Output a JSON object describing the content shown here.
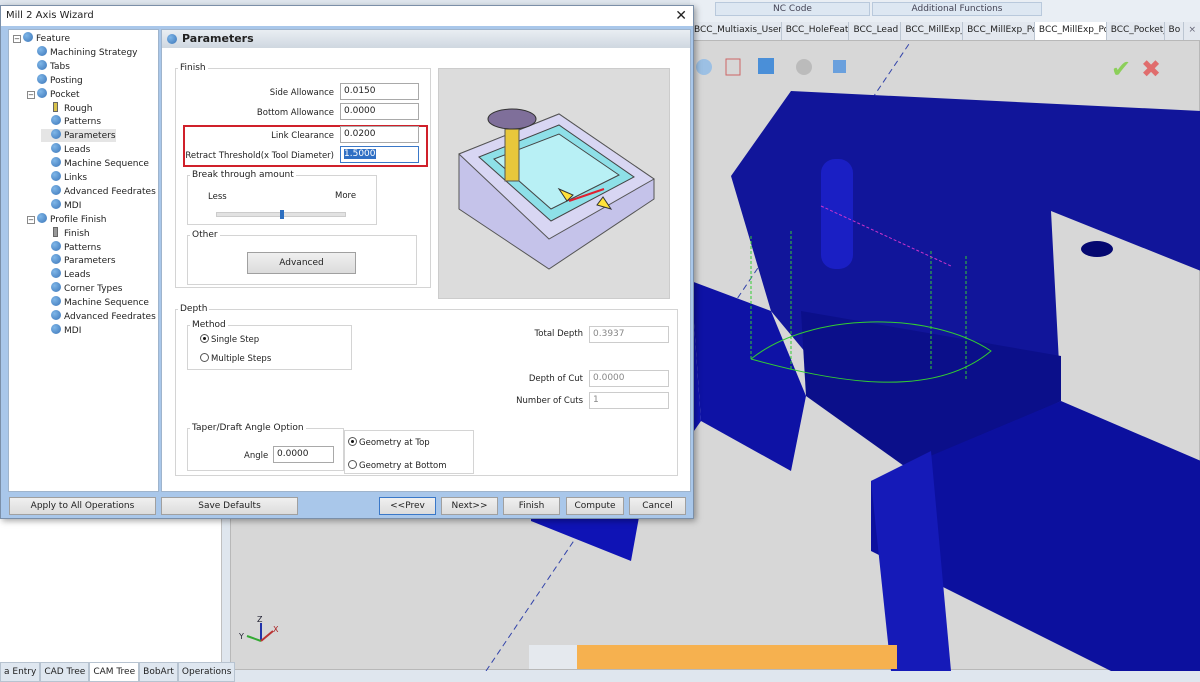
{
  "ribbon": {
    "tabs": [
      "NC Code",
      "Additional Functions"
    ]
  },
  "doc_tabs": {
    "items": [
      "BCC_Multiaxis_UserD",
      "BCC_HoleFeatu",
      "BCC_Lead",
      "BCC_MillExp_",
      "BCC_MillExp_Po",
      "BCC_MillExp_Po",
      "BCC_Pocket_",
      "Bo"
    ],
    "active": 5,
    "close": "×"
  },
  "bottom_tabs": {
    "items": [
      "a Entry",
      "CAD Tree",
      "CAM Tree",
      "BobArt",
      "Operations"
    ],
    "active": 2
  },
  "axis_triad": {
    "x": "X",
    "y": "Y",
    "z": "Z"
  },
  "dialog": {
    "title": "Mill 2 Axis Wizard",
    "close": "✕",
    "tree": [
      {
        "label": "Feature",
        "level": 0,
        "icon": "gear-icon",
        "expander": "−"
      },
      {
        "label": "Machining Strategy",
        "level": 1,
        "icon": "gear-icon"
      },
      {
        "label": "Tabs",
        "level": 1,
        "icon": "gear-icon"
      },
      {
        "label": "Posting",
        "level": 1,
        "icon": "gear-icon"
      },
      {
        "label": "Pocket",
        "level": 1,
        "icon": "settings-icon",
        "expander": "−"
      },
      {
        "label": "Rough",
        "level": 2,
        "icon": "tool-icon"
      },
      {
        "label": "Patterns",
        "level": 2,
        "icon": "gear-icon"
      },
      {
        "label": "Parameters",
        "level": 2,
        "icon": "gear-icon",
        "selected": true
      },
      {
        "label": "Leads",
        "level": 2,
        "icon": "gear-icon"
      },
      {
        "label": "Machine Sequence",
        "level": 2,
        "icon": "gear-icon"
      },
      {
        "label": "Links",
        "level": 2,
        "icon": "gear-icon"
      },
      {
        "label": "Advanced Feedrates",
        "level": 2,
        "icon": "gear-icon"
      },
      {
        "label": "MDI",
        "level": 2,
        "icon": "gear-icon"
      },
      {
        "label": "Profile Finish",
        "level": 1,
        "icon": "settings-icon",
        "expander": "−"
      },
      {
        "label": "Finish",
        "level": 2,
        "icon": "tool-icon"
      },
      {
        "label": "Patterns",
        "level": 2,
        "icon": "gear-icon"
      },
      {
        "label": "Parameters",
        "level": 2,
        "icon": "gear-icon"
      },
      {
        "label": "Leads",
        "level": 2,
        "icon": "gear-icon"
      },
      {
        "label": "Corner Types",
        "level": 2,
        "icon": "gear-icon"
      },
      {
        "label": "Machine Sequence",
        "level": 2,
        "icon": "gear-icon"
      },
      {
        "label": "Advanced Feedrates",
        "level": 2,
        "icon": "gear-icon"
      },
      {
        "label": "MDI",
        "level": 2,
        "icon": "gear-icon"
      }
    ],
    "panel_title": "Parameters",
    "finish": {
      "legend": "Finish",
      "side_allowance": {
        "label": "Side Allowance",
        "value": "0.0150"
      },
      "bottom_allowance": {
        "label": "Bottom Allowance",
        "value": "0.0000"
      },
      "link_clearance": {
        "label": "Link Clearance",
        "value": "0.0200"
      },
      "retract_threshold": {
        "label": "Retract Threshold(x Tool Diameter)",
        "value": "1.5000"
      },
      "highlight_color": "#d0202a",
      "break_through": {
        "legend": "Break through amount",
        "min_label": "Less",
        "max_label": "More",
        "level_fraction": 0.5
      },
      "other": {
        "legend": "Other",
        "advanced": "Advanced"
      }
    },
    "depth": {
      "legend": "Depth",
      "method": {
        "legend": "Method",
        "options": [
          "Single Step",
          "Multiple Steps"
        ],
        "selected": 0
      },
      "total_depth": {
        "label": "Total Depth",
        "value": "0.3937"
      },
      "depth_of_cut": {
        "label": "Depth of Cut",
        "value": "0.0000"
      },
      "number_of_cuts": {
        "label": "Number of Cuts",
        "value": "1"
      },
      "taper": {
        "legend": "Taper/Draft Angle Option",
        "angle_label": "Angle",
        "angle_value": "0.0000",
        "options": [
          "Geometry at Top",
          "Geometry at Bottom"
        ],
        "selected": 0
      }
    },
    "buttons": {
      "apply_all": "Apply to All Operations",
      "save_defaults": "Save Defaults",
      "prev": "<<Prev",
      "next": "Next>>",
      "finish": "Finish",
      "compute": "Compute",
      "cancel": "Cancel"
    }
  },
  "colors": {
    "model": "#0f12a8",
    "viewport": "#d7d7d7",
    "toolpath": "#33cc33"
  }
}
